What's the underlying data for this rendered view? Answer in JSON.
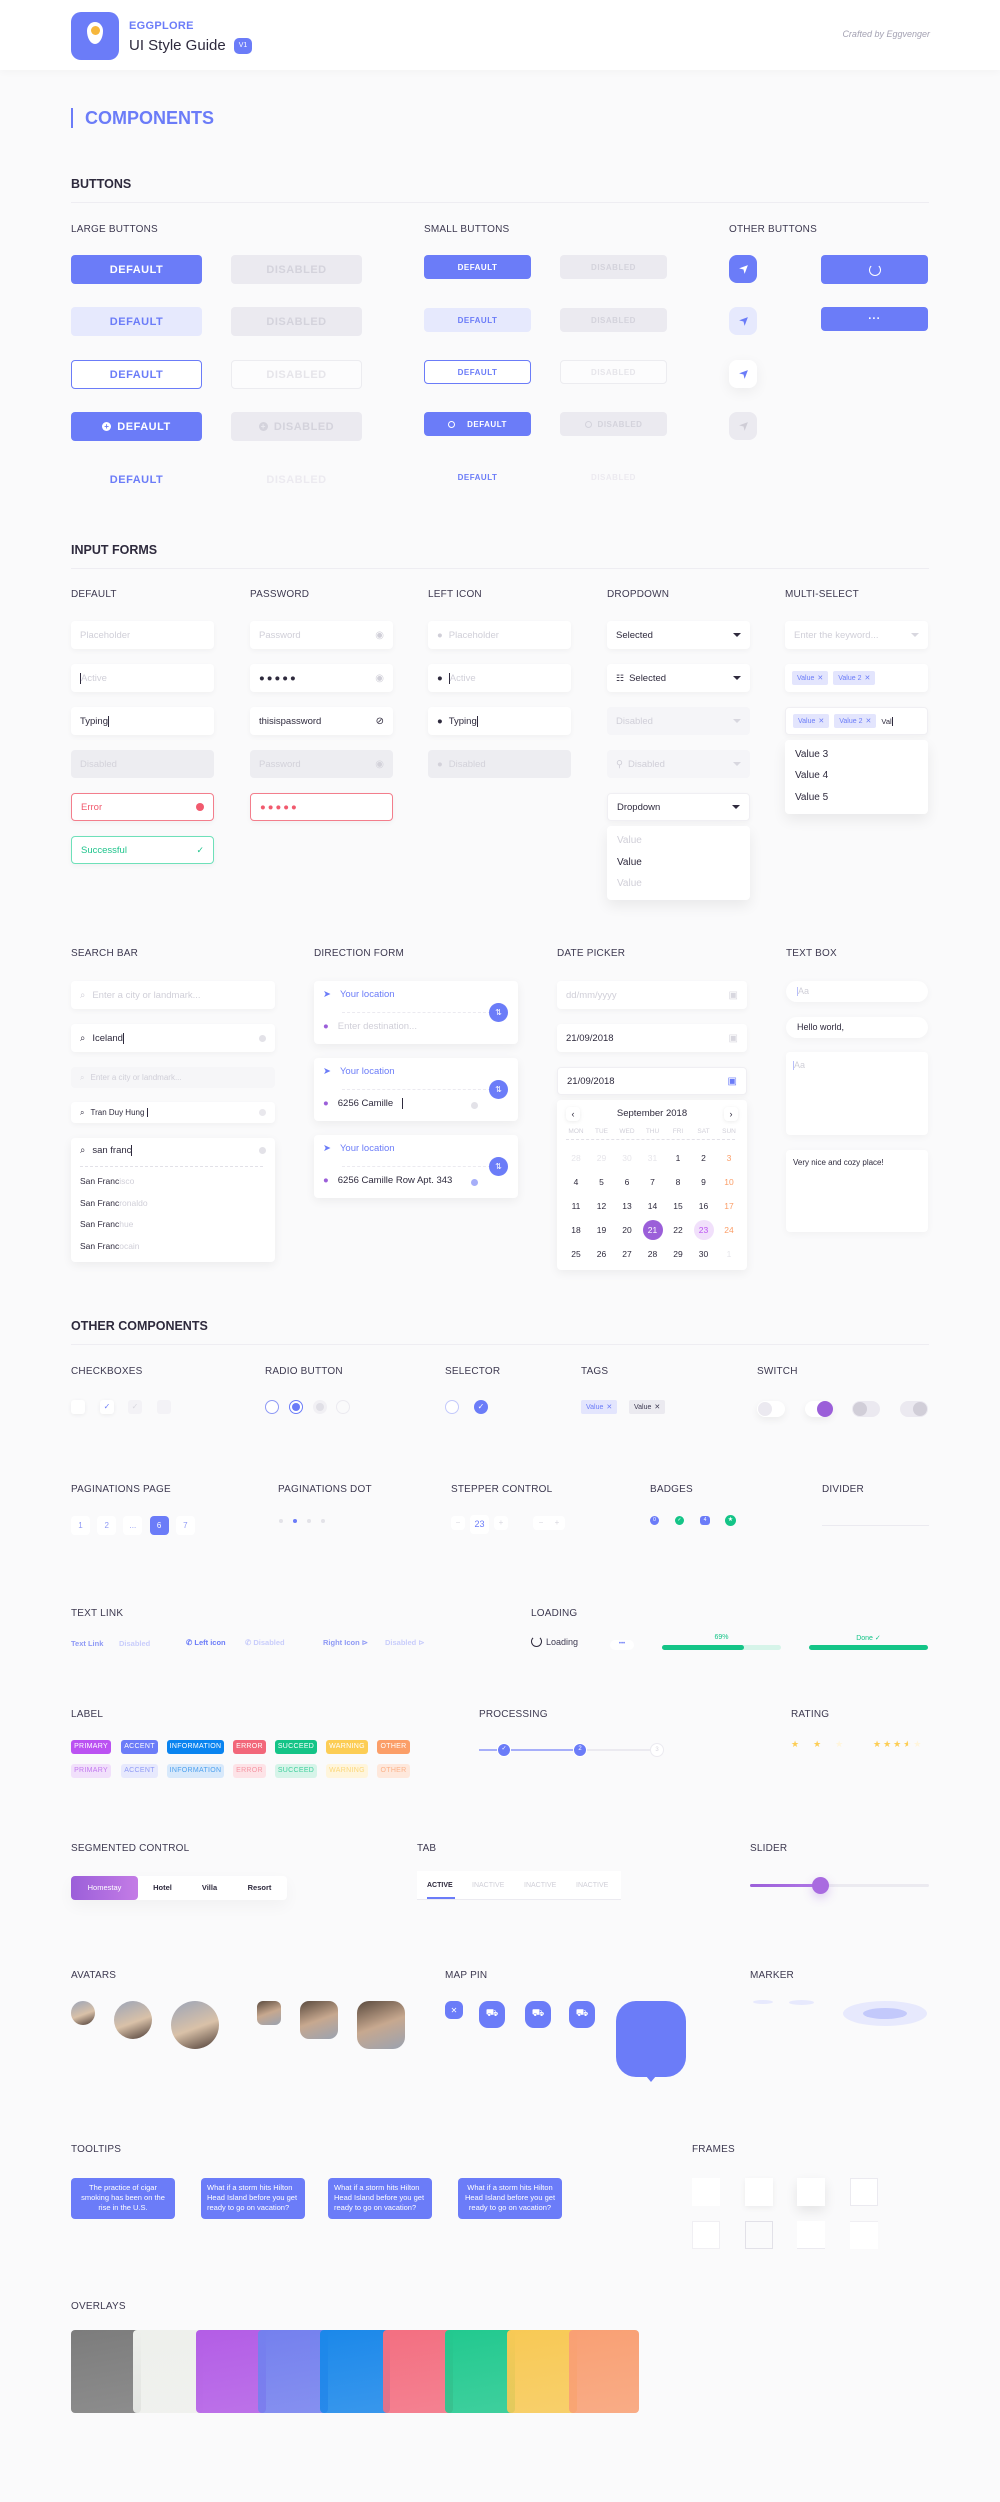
{
  "header": {
    "brand": "EGGPLORE",
    "title": "UI Style Guide",
    "version": "V1",
    "crafted": "Crafted by Eggvenger"
  },
  "page_heading": "COMPONENTS",
  "sections": {
    "buttons": "BUTTONS",
    "input_forms": "INPUT FORMS",
    "other_components": "OTHER COMPONENTS"
  },
  "buttons": {
    "large_label": "LARGE BUTTONS",
    "small_label": "SMALL BUTTONS",
    "other_label": "OTHER BUTTONS",
    "default": "DEFAULT",
    "disabled": "DISABLED",
    "more": "···"
  },
  "inputs": {
    "default_label": "DEFAULT",
    "password_label": "PASSWORD",
    "lefticon_label": "LEFT ICON",
    "dropdown_label": "DROPDOWN",
    "multiselect_label": "MULTI-SELECT",
    "default": {
      "placeholder": "Placeholder",
      "active": "Active",
      "typing": "Typing",
      "disabled": "Disabled",
      "error": "Error",
      "success": "Successful"
    },
    "password": {
      "placeholder": "Password",
      "masked": "●●●●●",
      "revealed": "thisispassword",
      "disabled": "Password",
      "error_masked": "●●●●●"
    },
    "lefticon": {
      "placeholder": "Placeholder",
      "active": "Active",
      "typing": "Typing",
      "disabled": "Disabled"
    },
    "dropdown": {
      "selected": "Selected",
      "selected_icon": "Selected",
      "disabled": "Disabled",
      "disabled_icon": "Disabled",
      "open": "Dropdown",
      "options": [
        "Value",
        "Value",
        "Value"
      ]
    },
    "multiselect": {
      "placeholder": "Enter the keyword...",
      "chips": [
        "Value",
        "Value 2"
      ],
      "typing": "Val",
      "options": [
        "Value 3",
        "Value 4",
        "Value 5"
      ]
    }
  },
  "search": {
    "label": "SEARCH BAR",
    "placeholder": "Enter a city or landmark...",
    "value1": "Iceland",
    "value2": "Tran Duy Hung",
    "value3": "san franc",
    "suggestions": [
      {
        "match": "San Franc",
        "rest": "isco"
      },
      {
        "match": "San Franc",
        "rest": "ronaldo"
      },
      {
        "match": "San Franc",
        "rest": "hue"
      },
      {
        "match": "San Franc",
        "rest": "ocain"
      }
    ]
  },
  "direction": {
    "label": "DIRECTION FORM",
    "origin": "Your location",
    "dest_placeholder": "Enter destination...",
    "dest_typing": "6256 Camille",
    "dest_full": "6256 Camille Row Apt. 343"
  },
  "datepicker": {
    "label": "DATE PICKER",
    "placeholder": "dd/mm/yyyy",
    "value": "21/09/2018",
    "month": "September 2018",
    "weekdays": [
      "MON",
      "TUE",
      "WED",
      "THU",
      "FRI",
      "SAT",
      "SUN"
    ],
    "weeks": [
      [
        "28",
        "29",
        "30",
        "31",
        "1",
        "2",
        "3"
      ],
      [
        "4",
        "5",
        "6",
        "7",
        "8",
        "9",
        "10"
      ],
      [
        "11",
        "12",
        "13",
        "14",
        "15",
        "16",
        "17"
      ],
      [
        "18",
        "19",
        "20",
        "21",
        "22",
        "23",
        "24"
      ],
      [
        "25",
        "26",
        "27",
        "28",
        "29",
        "30",
        "1"
      ]
    ],
    "selected": "21",
    "highlighted": "23"
  },
  "textbox": {
    "label": "TEXT BOX",
    "placeholder": "Aa",
    "value_single": "Hello world,",
    "value_multi": "Very nice and cozy place!"
  },
  "checkboxes": {
    "label": "CHECKBOXES"
  },
  "radio": {
    "label": "RADIO BUTTON"
  },
  "selector": {
    "label": "SELECTOR"
  },
  "tags": {
    "label": "TAGS",
    "items": [
      "Value",
      "Value"
    ]
  },
  "switch": {
    "label": "SWITCH"
  },
  "pagination_page": {
    "label": "PAGINATIONS PAGE",
    "pages": [
      "1",
      "2",
      "...",
      "6",
      "7"
    ],
    "current": "6"
  },
  "pagination_dot": {
    "label": "PAGINATIONS DOT",
    "count": 4,
    "current": 2
  },
  "stepper": {
    "label": "STEPPER CONTROL",
    "value": "23",
    "minus": "−",
    "plus": "+"
  },
  "badges": {
    "label": "BADGES",
    "items": [
      "0",
      "✓",
      "4",
      "★"
    ]
  },
  "divider": {
    "label": "DIVIDER"
  },
  "textlink": {
    "label": "TEXT LINK",
    "link": "Text Link",
    "disabled": "Disabled",
    "left_icon": "Left icon",
    "right_icon": "Right Icon"
  },
  "loading": {
    "label": "LOADING",
    "text": "Loading",
    "progress_percent": 69,
    "progress_text": "69%",
    "done_text": "Done ✓"
  },
  "labels": {
    "label": "LABEL",
    "items": [
      {
        "text": "PRIMARY",
        "color": "#bb52f2",
        "light": "#f1e0fb",
        "light_text": "#c278ef"
      },
      {
        "text": "ACCENT",
        "color": "#6b7cf8",
        "light": "#e7e9fd",
        "light_text": "#8e99f5"
      },
      {
        "text": "INFORMATION",
        "color": "#0a84f0",
        "light": "#d8e9fb",
        "light_text": "#4ea1ee"
      },
      {
        "text": "ERROR",
        "color": "#f2677a",
        "light": "#fde3e7",
        "light_text": "#f597a4"
      },
      {
        "text": "SUCCEED",
        "color": "#14c487",
        "light": "#d6f4e9",
        "light_text": "#3ecf9c"
      },
      {
        "text": "WARNING",
        "color": "#fccd55",
        "light": "#fff5dc",
        "light_text": "#fbd77a"
      },
      {
        "text": "OTHER",
        "color": "#fb9e68",
        "light": "#fee8dc",
        "light_text": "#fbb28a"
      }
    ]
  },
  "processing": {
    "label": "PROCESSING",
    "steps": [
      "✓",
      "2",
      "3"
    ],
    "current_step": 2
  },
  "rating": {
    "label": "RATING",
    "value_small": 1.5,
    "max_small": 3,
    "value_large": 3.5,
    "max_large": 5
  },
  "segmented": {
    "label": "SEGMENTED CONTROL",
    "items": [
      "Homestay",
      "Hotel",
      "Villa",
      "Resort"
    ],
    "active": 0
  },
  "tab": {
    "label": "TAB",
    "items": [
      "ACTIVE",
      "INACTIVE",
      "INACTIVE",
      "INACTIVE"
    ]
  },
  "slider": {
    "label": "SLIDER",
    "value_fraction": 0.39
  },
  "avatars": {
    "label": "AVATARS"
  },
  "mappin": {
    "label": "MAP PIN"
  },
  "marker": {
    "label": "MARKER"
  },
  "tooltips": {
    "label": "TOOLTIPS",
    "items": [
      "The practice of cigar smoking has been on the rise in the U.S.",
      "What if a storm hits Hilton Head Island before you get ready to go on vacation?",
      "What if a storm hits Hilton Head Island before you get ready to go on vacation?",
      "What if a storm hits Hilton Head Island before you get ready to go on vacation?"
    ]
  },
  "frames": {
    "label": "FRAMES"
  },
  "overlays": {
    "label": "OVERLAYS",
    "colors": [
      "#7c7c7c",
      "#eef0ec",
      "#b35de6",
      "#7480ee",
      "#1b88ea",
      "#f36f81",
      "#22c98f",
      "#f8c955",
      "#f9a074"
    ]
  },
  "colors": {
    "accent": "#6b7cf8",
    "purple": "#9b5fd9",
    "success": "#14c487",
    "error": "#f15a6e"
  }
}
